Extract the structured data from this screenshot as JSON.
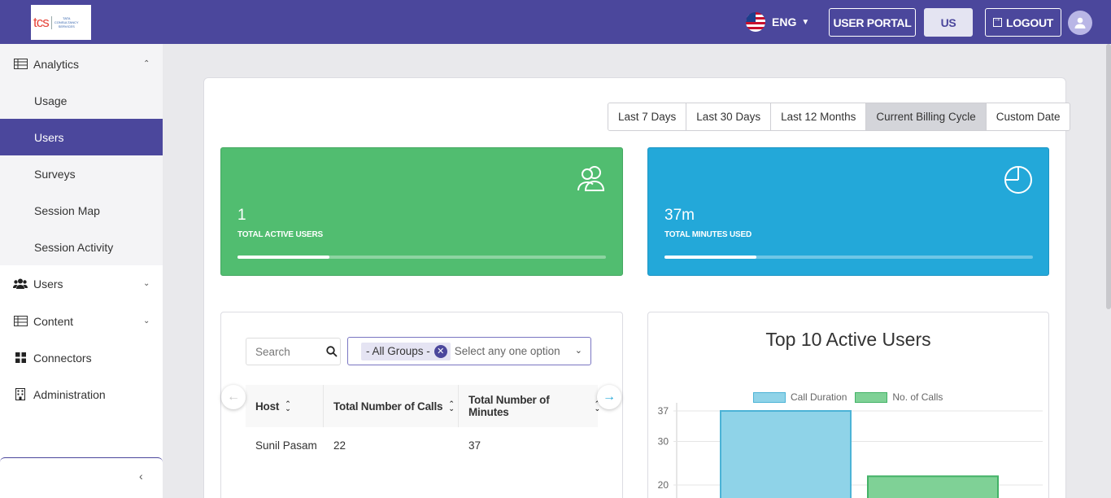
{
  "header": {
    "language": "ENG",
    "user_portal_label": "USER PORTAL",
    "region_label": "US",
    "logout_label": "LOGOUT",
    "logo_text": "tcs",
    "logo_subtext": "TATA CONSULTANCY SERVICES"
  },
  "sidebar": {
    "items": [
      {
        "label": "Analytics",
        "icon": "table-icon",
        "expanded": true
      },
      {
        "label": "Usage"
      },
      {
        "label": "Users",
        "active": true
      },
      {
        "label": "Surveys"
      },
      {
        "label": "Session Map"
      },
      {
        "label": "Session Activity"
      },
      {
        "label": "Users",
        "icon": "users-icon"
      },
      {
        "label": "Content",
        "icon": "table-icon"
      },
      {
        "label": "Connectors",
        "icon": "grid-icon"
      },
      {
        "label": "Administration",
        "icon": "building-icon"
      }
    ],
    "collapse_glyph": "‹"
  },
  "date_ranges": {
    "options": [
      "Last 7 Days",
      "Last 30 Days",
      "Last 12 Months",
      "Current Billing Cycle",
      "Custom Date"
    ],
    "selected": "Current Billing Cycle"
  },
  "stats": {
    "active_users": {
      "value": "1",
      "caption": "TOTAL ACTIVE USERS",
      "progress": 0.25,
      "color": "#51bd70"
    },
    "minutes_used": {
      "value": "37m",
      "caption": "TOTAL MINUTES USED",
      "progress": 0.25,
      "color": "#23a8d9"
    }
  },
  "table": {
    "search_placeholder": "Search",
    "group_chip": "- All Groups -",
    "group_placeholder": "Select any one option",
    "columns": [
      "Host",
      "Total Number of Calls",
      "Total Number of Minutes"
    ],
    "rows": [
      [
        "Sunil Pasam",
        "22",
        "37"
      ]
    ]
  },
  "chart_data": {
    "type": "bar",
    "title": "Top 10 Active Users",
    "categories": [
      ""
    ],
    "series": [
      {
        "name": "Call Duration",
        "values": [
          37
        ],
        "color": "#8fd3e8"
      },
      {
        "name": "No. of Calls",
        "values": [
          22
        ],
        "color": "#7fd196"
      }
    ],
    "yticks": [
      "37",
      "30",
      "20"
    ],
    "ylim": [
      0,
      37
    ],
    "legend": "top"
  }
}
